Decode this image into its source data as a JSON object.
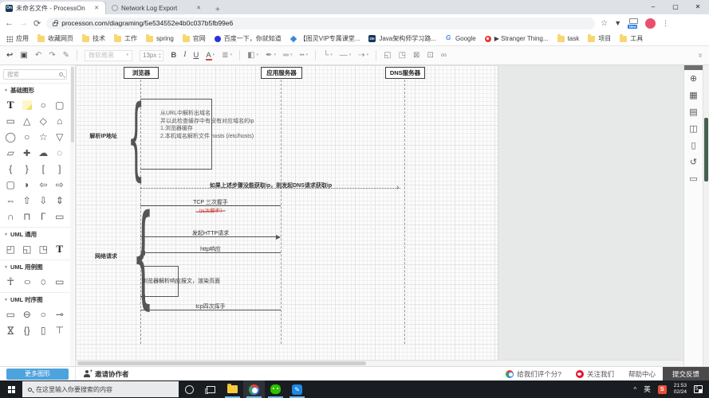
{
  "accent_colors": {
    "processon_blue": "#4da3dc",
    "selection_green": "#46604f",
    "taskbar_dark": "#191c20",
    "feedback_dark": "#4a4a4a",
    "red_note": "#c0392b"
  },
  "browser": {
    "tabs": [
      {
        "title": "未命名文件 - ProcessOn",
        "close": "✕",
        "active": true
      },
      {
        "title": "Network Log Export",
        "close": "✕",
        "active": false
      }
    ],
    "new_tab": "+",
    "window_controls": {
      "minimize": "–",
      "maximize": "▢",
      "close": "✕"
    },
    "url": "processon.com/diagraming/5e534552e4b0c037b5fb99e6",
    "extensions_new_badge": "New",
    "kebab": "⋮",
    "star": "☆",
    "bookmarks": [
      {
        "label": "应用",
        "icon": "apps-grid"
      },
      {
        "label": "收藏网页",
        "icon": "folder"
      },
      {
        "label": "技术",
        "icon": "folder"
      },
      {
        "label": "工作",
        "icon": "folder"
      },
      {
        "label": "spring",
        "icon": "folder"
      },
      {
        "label": "官网",
        "icon": "folder"
      },
      {
        "label": "百度一下，你就知道",
        "icon": "baidu-paw"
      },
      {
        "label": "【图灵VIP专属课堂...",
        "icon": "blue-gem"
      },
      {
        "label": "Java架构师学习路...",
        "icon": "processon-on"
      },
      {
        "label": "Google",
        "icon": "google-g"
      },
      {
        "label": "▶ Stranger Thing...",
        "icon": "red-circle"
      },
      {
        "label": "task",
        "icon": "folder"
      },
      {
        "label": "项目",
        "icon": "folder"
      },
      {
        "label": "工具",
        "icon": "folder"
      }
    ]
  },
  "toolbar": {
    "collapse": "»",
    "items": [
      {
        "g": "↩",
        "n": "back-icon",
        "v": "dark"
      },
      {
        "g": "▣",
        "n": "shape-panel-icon",
        "v": "dark"
      },
      {
        "g": "↶",
        "n": "undo-icon"
      },
      {
        "g": "↷",
        "n": "redo-icon"
      },
      {
        "g": "✎",
        "n": "format-painter-icon"
      },
      {
        "n": "separator",
        "v": "sep"
      },
      {
        "g": "微软雅黑",
        "n": "font-family-select",
        "v": "disabled dd"
      },
      {
        "g": "13px",
        "n": "font-size-input",
        "v": "stepper"
      },
      {
        "g": "B",
        "n": "bold-button",
        "v": "bold"
      },
      {
        "g": "I",
        "n": "italic-button",
        "v": "italic"
      },
      {
        "g": "U",
        "n": "underline-button",
        "v": "underline"
      },
      {
        "g": "A",
        "n": "font-color-button",
        "v": "fontcolor dd"
      },
      {
        "g": "≣",
        "n": "align-button",
        "v": "dd"
      },
      {
        "n": "separator",
        "v": "sep"
      },
      {
        "g": "◧",
        "n": "fill-color-icon",
        "v": "dd"
      },
      {
        "g": "✒",
        "n": "line-color-icon",
        "v": "dd"
      },
      {
        "g": "═",
        "n": "line-width-icon",
        "v": "dd"
      },
      {
        "g": "┅",
        "n": "line-dash-icon",
        "v": "dd"
      },
      {
        "n": "separator",
        "v": "sep"
      },
      {
        "g": "└",
        "n": "connector-type-icon",
        "v": "dd"
      },
      {
        "g": "—",
        "n": "line-type-icon",
        "v": "dd"
      },
      {
        "g": "⇢",
        "n": "arrow-style-icon",
        "v": "dd"
      },
      {
        "n": "separator",
        "v": "sep"
      },
      {
        "g": "◱",
        "n": "bring-front-icon"
      },
      {
        "g": "◳",
        "n": "send-back-icon"
      },
      {
        "g": "⊠",
        "n": "lock-icon"
      },
      {
        "g": "⊡",
        "n": "unlock-icon"
      },
      {
        "g": "∞",
        "n": "hyperlink-icon"
      }
    ]
  },
  "sidebar": {
    "search_placeholder": "搜索",
    "sections": {
      "basic_title": "基础图形",
      "uml_common_title": "UML 通用",
      "uml_usecase_title": "UML 用例图",
      "uml_sequence_title": "UML 时序图"
    },
    "basic_shapes": [
      {
        "g": "T",
        "n": "text-shape"
      },
      {
        "g": "",
        "n": "sticky-note-shape"
      },
      {
        "g": "○",
        "n": "circle-shape"
      },
      {
        "g": "▢",
        "n": "rounded-rect-shape"
      },
      {
        "g": "▭",
        "n": "rect-shape"
      },
      {
        "g": "△",
        "n": "triangle-shape"
      },
      {
        "g": "◇",
        "n": "diamond-shape"
      },
      {
        "g": "⌂",
        "n": "pentagon-shape"
      },
      {
        "g": "◯",
        "n": "heptagon-shape"
      },
      {
        "g": "○",
        "n": "octagon-shape"
      },
      {
        "g": "☆",
        "n": "star-shape"
      },
      {
        "g": "▽",
        "n": "inverted-triangle-shape"
      },
      {
        "g": "▱",
        "n": "trapezoid-shape"
      },
      {
        "g": "✚",
        "n": "cross-shape"
      },
      {
        "g": "☁",
        "n": "cloud-shape"
      },
      {
        "g": "◌",
        "n": "callout-shape"
      },
      {
        "g": "{",
        "n": "brace-left-shape"
      },
      {
        "g": "}",
        "n": "brace-right-shape"
      },
      {
        "g": "[",
        "n": "bracket-left-shape"
      },
      {
        "g": "]",
        "n": "bracket-right-shape"
      },
      {
        "g": "▢",
        "n": "rounded-rect2-shape"
      },
      {
        "g": "◗",
        "n": "d-shape"
      },
      {
        "g": "⇦",
        "n": "arrow-left-shape"
      },
      {
        "g": "⇨",
        "n": "arrow-right-shape"
      },
      {
        "g": "⇔",
        "n": "arrow-double-h-shape"
      },
      {
        "g": "⇧",
        "n": "arrow-up-shape"
      },
      {
        "g": "⇩",
        "n": "arrow-down-shape"
      },
      {
        "g": "⇕",
        "n": "arrow-double-v-shape"
      },
      {
        "g": "∩",
        "n": "u-round-shape"
      },
      {
        "g": "⊓",
        "n": "u-square-shape"
      },
      {
        "g": "Γ",
        "n": "corner-shape"
      },
      {
        "g": "▭",
        "n": "rect2-shape"
      }
    ],
    "uml_common_shapes": [
      {
        "g": "◰",
        "n": "package-shape"
      },
      {
        "g": "◱",
        "n": "folder-shape"
      },
      {
        "g": "◳",
        "n": "note-shape"
      },
      {
        "g": "T",
        "n": "text-shape"
      }
    ],
    "uml_usecase_shapes": [
      {
        "g": "☥",
        "n": "actor-shape"
      },
      {
        "g": "○",
        "n": "ellipse-shape"
      },
      {
        "g": "○",
        "n": "tall-oval-shape"
      },
      {
        "g": "▭",
        "n": "rect-shape"
      }
    ],
    "uml_sequence_shapes": [
      {
        "g": "▭",
        "n": "object-shape"
      },
      {
        "g": "⊖",
        "n": "lifeline-shape"
      },
      {
        "g": "○",
        "n": "entity-shape"
      },
      {
        "g": "⊸",
        "n": "boundary-shape"
      },
      {
        "g": "⋈",
        "n": "hourglass-shape"
      },
      {
        "g": "{}",
        "n": "constraint-shape"
      },
      {
        "g": "▯",
        "n": "activation-shape"
      },
      {
        "g": "⊤",
        "n": "tbar-shape"
      }
    ],
    "more_shapes_label": "更多图形"
  },
  "diagram": {
    "actors": {
      "browser": "浏览器",
      "app_server": "应用服务器",
      "dns_server": "DNS服务器"
    },
    "brace1_label": "解析IP地址",
    "brace2_label": "网络请求",
    "note_lines": [
      "从URL中解析出域名",
      "并以此检查缓存中有没有对应域名的ip",
      "1.浏览器缓存",
      "2.本机域名解析文件 hosts  (/etc/hosts)"
    ],
    "dns_message": "如果上述步骤没能获取ip，则发起DNS请求获取ip",
    "tcp_handshake": "TCP 三次握手",
    "tcp_handshake_note": "（N次握手）",
    "http_request": "发起HTTP请求",
    "http_response": "http响应",
    "render_note": "浏览器解析响应报文，渲染页面",
    "tcp_close": "tcp四次挥手"
  },
  "right_panel_icons": [
    {
      "g": "⊕",
      "n": "locate-icon"
    },
    {
      "g": "▦",
      "n": "style-icon"
    },
    {
      "g": "▤",
      "n": "clipboard-icon"
    },
    {
      "g": "◫",
      "n": "copy-page-icon"
    },
    {
      "g": "▯",
      "n": "new-page-icon"
    },
    {
      "g": "↺",
      "n": "history-icon"
    },
    {
      "g": "▭",
      "n": "comment-icon"
    }
  ],
  "footer": {
    "invite": "邀请协作者",
    "rate": "给我们评个分?",
    "follow": "关注我们",
    "help": "帮助中心",
    "feedback": "提交反馈"
  },
  "taskbar": {
    "search_placeholder": "在这里输入你要搜索的内容",
    "tray": {
      "caret": "^",
      "lang": "英",
      "time": "21:53",
      "date": "02/24",
      "badge": "5",
      "snagit": "S"
    }
  }
}
